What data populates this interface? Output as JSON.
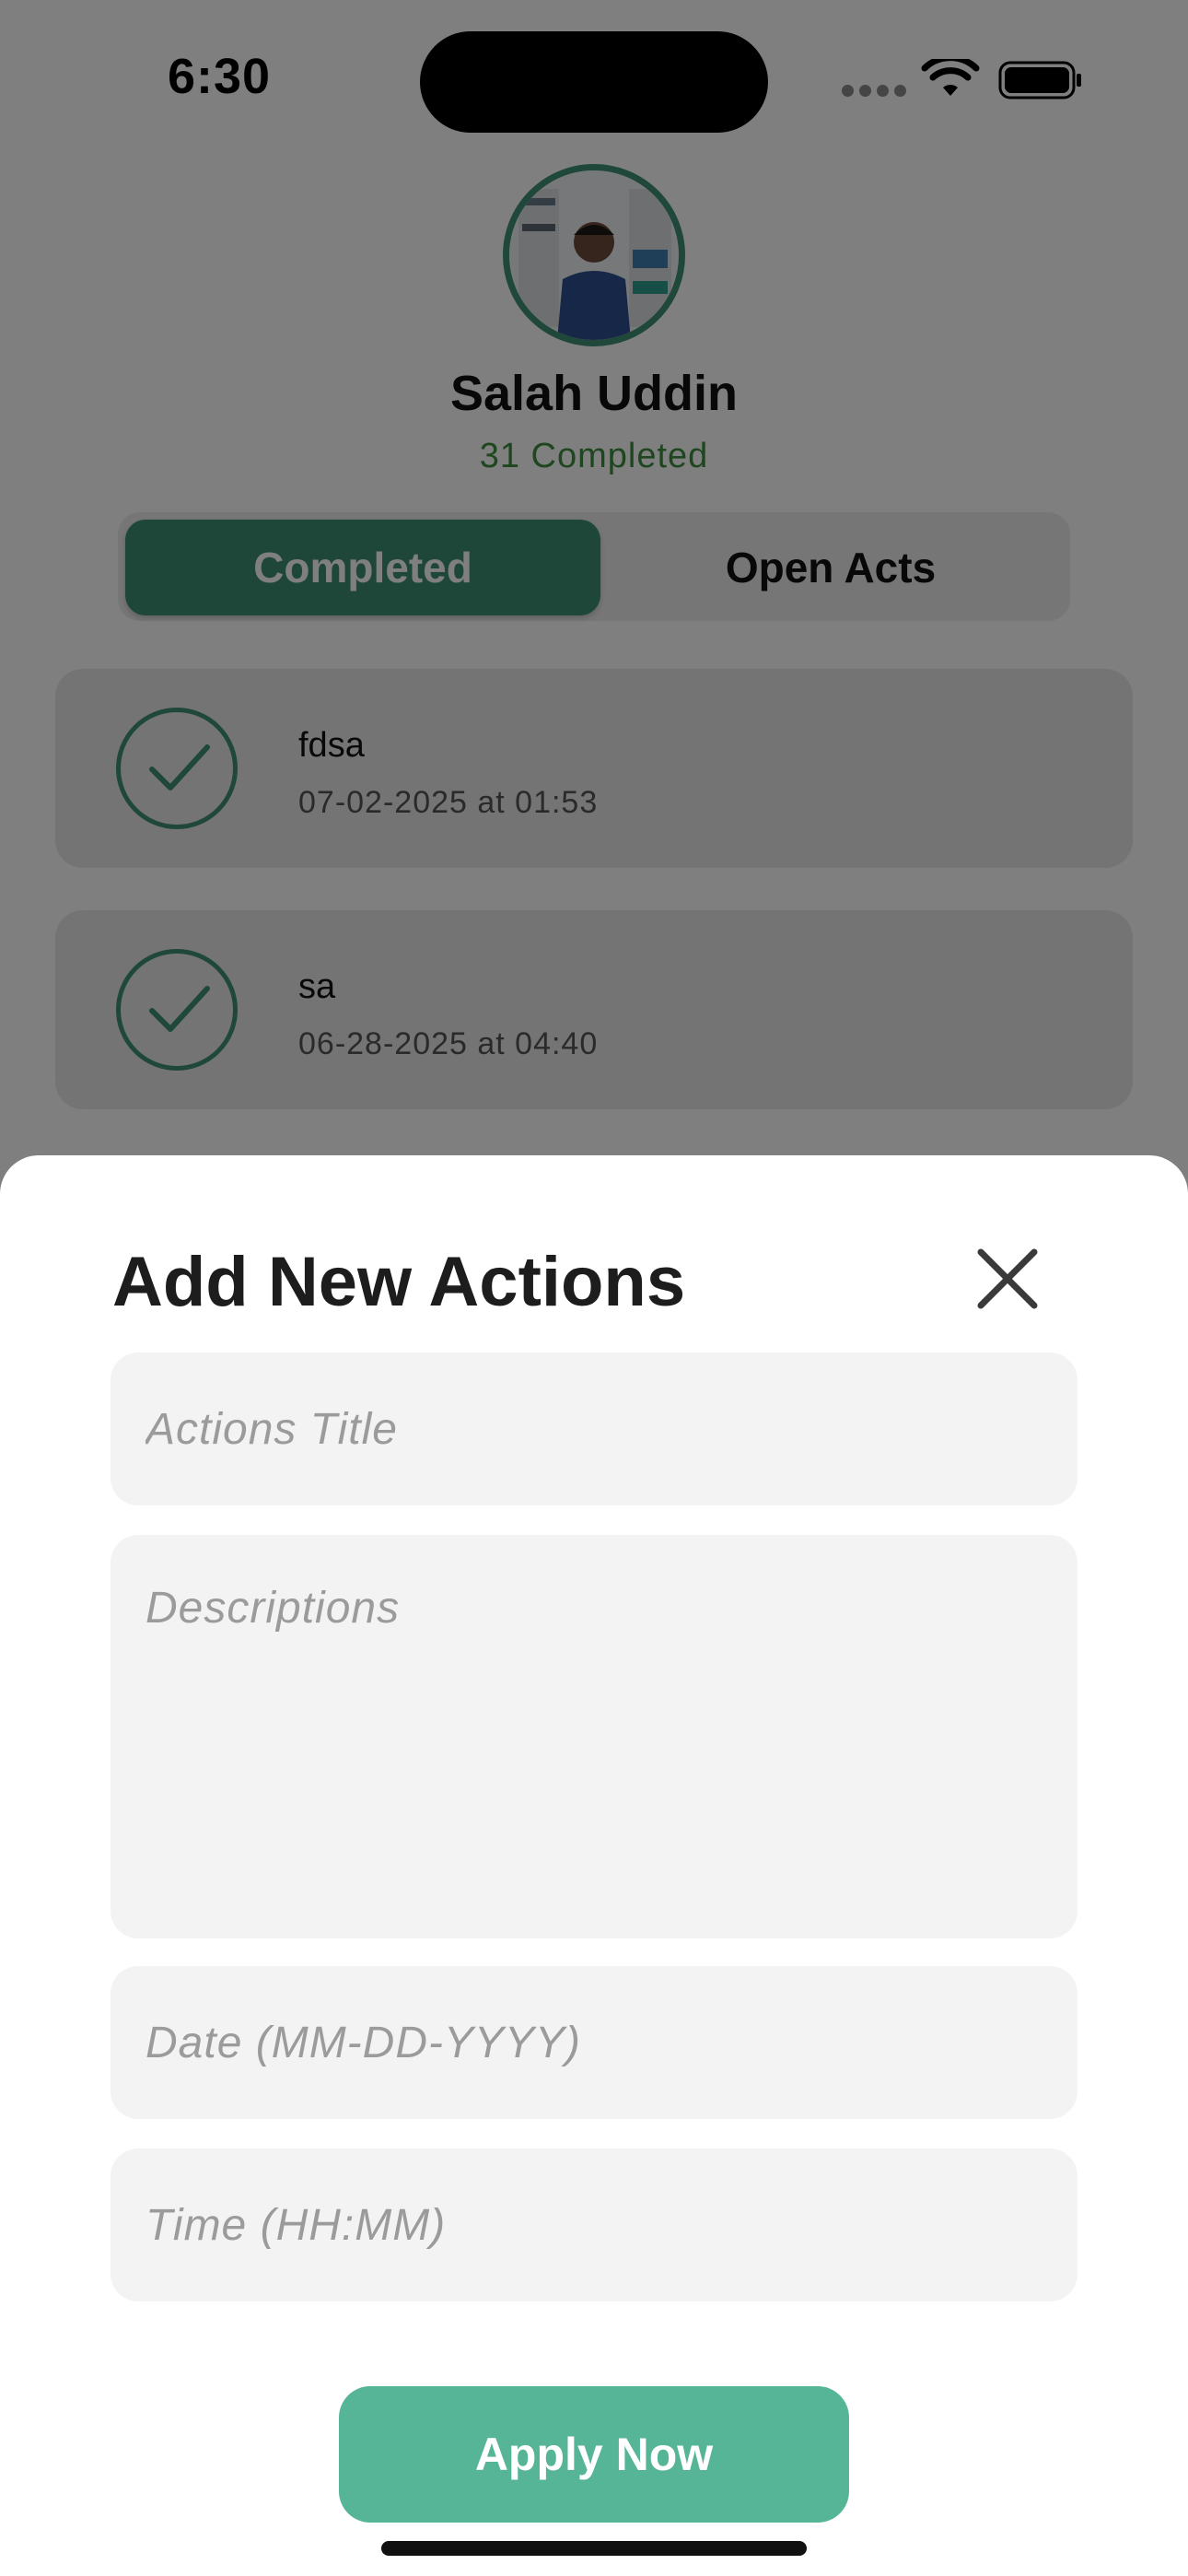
{
  "status_bar": {
    "time": "6:30"
  },
  "profile": {
    "name": "Salah Uddin",
    "completed_text": "31 Completed"
  },
  "tabs": [
    {
      "label": "Completed",
      "active": true
    },
    {
      "label": "Open Acts",
      "active": false
    }
  ],
  "actions": [
    {
      "title": "fdsa",
      "datetime": "07-02-2025 at 01:53"
    },
    {
      "title": "sa",
      "datetime": "06-28-2025 at 04:40"
    }
  ],
  "sheet": {
    "title": "Add New Actions",
    "title_placeholder": "Actions Title",
    "description_placeholder": "Descriptions",
    "date_placeholder": "Date (MM-DD-YYYY)",
    "time_placeholder": "Time (HH:MM)",
    "submit_label": "Apply Now"
  },
  "colors": {
    "accent": "#3d8f74",
    "button": "#55b596",
    "completed_text": "#3d8f3f",
    "overlay": "rgba(0,0,0,0.5)"
  },
  "icons": [
    "wifi-icon",
    "battery-icon",
    "checkmark-icon",
    "close-icon"
  ]
}
